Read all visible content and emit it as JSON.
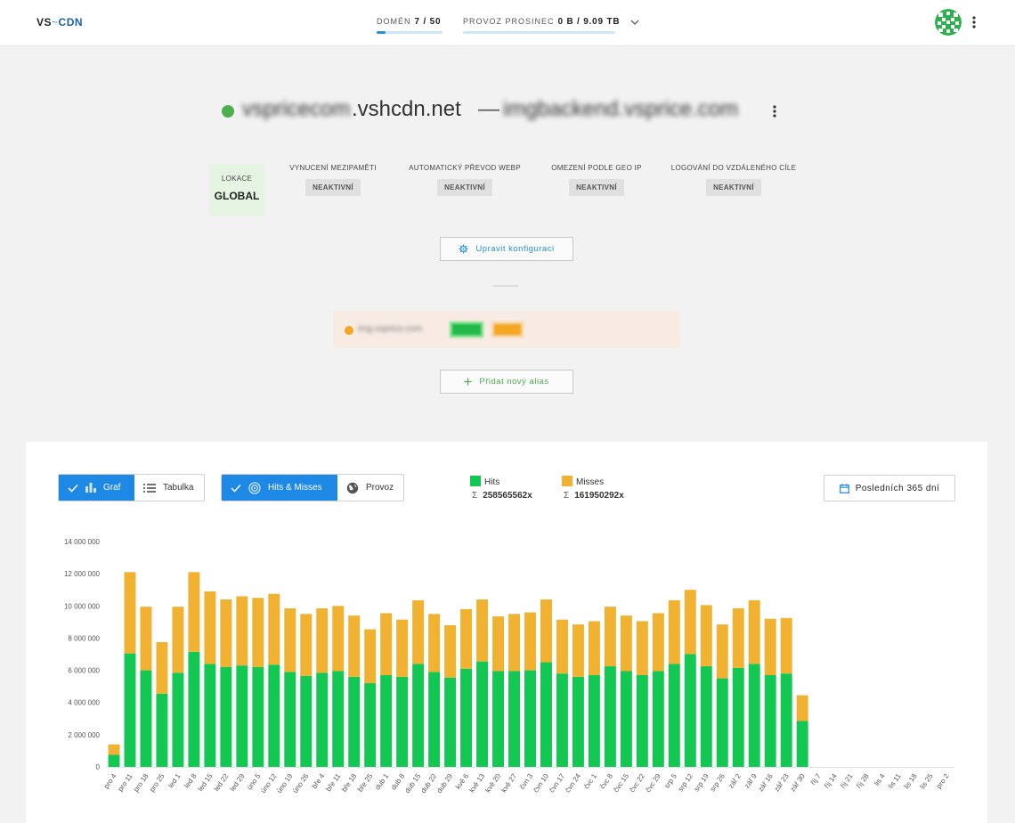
{
  "header": {
    "logo_vs": "VS",
    "logo_tilde": "~",
    "logo_cdn": "CDN",
    "domains_label": "Domén",
    "domains_value": "7 / 50",
    "domains_fraction": 0.14,
    "traffic_label": "Provoz prosinec",
    "traffic_value": "0 B / 9.09 TB",
    "traffic_fraction": 0.0
  },
  "title": {
    "hostname_prefix": "vspricecom",
    "domain_suffix": ".vshcdn.net",
    "separator": "—",
    "origin": "imgbackend.vsprice.com",
    "status_color": "#4caf50"
  },
  "features": {
    "location_label": "Lokace",
    "location_value": "GLOBAL",
    "items": [
      {
        "label": "Vynucení mezipaměti",
        "status": "NEAKTIVNÍ"
      },
      {
        "label": "Automatický převod WebP",
        "status": "NEAKTIVNÍ"
      },
      {
        "label": "Omezení podle GEO IP",
        "status": "NEAKTIVNÍ"
      },
      {
        "label": "Logování do vzdáleného cíle",
        "status": "NEAKTIVNÍ"
      }
    ]
  },
  "buttons": {
    "edit_config": "Upravit konfiguraci",
    "add_alias": "Přidat nový alias"
  },
  "alias": {
    "hostname": "img.vsprice.com",
    "badge1": "SSL",
    "badge2": "CF",
    "dot_color": "#f5a623"
  },
  "toolbar": {
    "view_graph": "Graf",
    "view_table": "Tabulka",
    "metric_hits_misses": "Hits & Misses",
    "metric_traffic": "Provoz",
    "range": "Posledních 365 dní"
  },
  "legend": {
    "hits_label": "Hits",
    "hits_sum_symbol": "Σ",
    "hits_sum": "258565562x",
    "misses_label": "Misses",
    "misses_sum_symbol": "Σ",
    "misses_sum": "161950292x",
    "hits_color": "#12c852",
    "misses_color": "#f0b230"
  },
  "chart_data": {
    "type": "bar",
    "stacked": true,
    "ylim": [
      0,
      14000000
    ],
    "yticks": [
      "0",
      "2 000 000",
      "4 000 000",
      "6 000 000",
      "8 000 000",
      "10 000 000",
      "12 000 000",
      "14 000 000"
    ],
    "ytick_values": [
      0,
      2000000,
      4000000,
      6000000,
      8000000,
      10000000,
      12000000,
      14000000
    ],
    "categories": [
      "pro 4",
      "pro 11",
      "pro 18",
      "pro 25",
      "led 1",
      "led 8",
      "led 15",
      "led 22",
      "led 29",
      "úno 5",
      "úno 12",
      "úno 19",
      "úno 26",
      "bře 4",
      "bře 11",
      "bře 18",
      "bře 25",
      "dub 1",
      "dub 8",
      "dub 15",
      "dub 22",
      "dub 29",
      "kvě 6",
      "kvě 13",
      "kvě 20",
      "kvě 27",
      "čvn 3",
      "čvn 10",
      "čvn 17",
      "čvn 24",
      "čvc 1",
      "čvc 8",
      "čvc 15",
      "čvc 22",
      "čvc 29",
      "srp 5",
      "srp 12",
      "srp 19",
      "srp 26",
      "zář 2",
      "zář 9",
      "zář 16",
      "zář 23",
      "zář 30",
      "říj 7",
      "říj 14",
      "říj 21",
      "říj 28",
      "lis 4",
      "lis 11",
      "lis 18",
      "lis 25",
      "pro 2"
    ],
    "series": [
      {
        "name": "Hits",
        "color": "#12c852",
        "values": [
          750000,
          7050000,
          6000000,
          4550000,
          5850000,
          7150000,
          6400000,
          6200000,
          6300000,
          6200000,
          6350000,
          5900000,
          5650000,
          5850000,
          5950000,
          5600000,
          5200000,
          5700000,
          5600000,
          6400000,
          5900000,
          5550000,
          6100000,
          6550000,
          5950000,
          5950000,
          6000000,
          6500000,
          5800000,
          5600000,
          5700000,
          6250000,
          5950000,
          5700000,
          5950000,
          6400000,
          7000000,
          6250000,
          5500000,
          6150000,
          6400000,
          5700000,
          5800000,
          2850000,
          0,
          0,
          0,
          0,
          0,
          0,
          0,
          0,
          0
        ]
      },
      {
        "name": "Misses",
        "color": "#f0b230",
        "values": [
          650000,
          5050000,
          3950000,
          3200000,
          4100000,
          4950000,
          4500000,
          4200000,
          4300000,
          4300000,
          4400000,
          3950000,
          3850000,
          4000000,
          4050000,
          3800000,
          3350000,
          3850000,
          3550000,
          3950000,
          3600000,
          3250000,
          3700000,
          3850000,
          3400000,
          3550000,
          3600000,
          3900000,
          3350000,
          3250000,
          3350000,
          3700000,
          3450000,
          3350000,
          3600000,
          3950000,
          4000000,
          3800000,
          3350000,
          3700000,
          3950000,
          3500000,
          3450000,
          1600000,
          0,
          0,
          0,
          0,
          0,
          0,
          0,
          0,
          0
        ]
      }
    ]
  }
}
